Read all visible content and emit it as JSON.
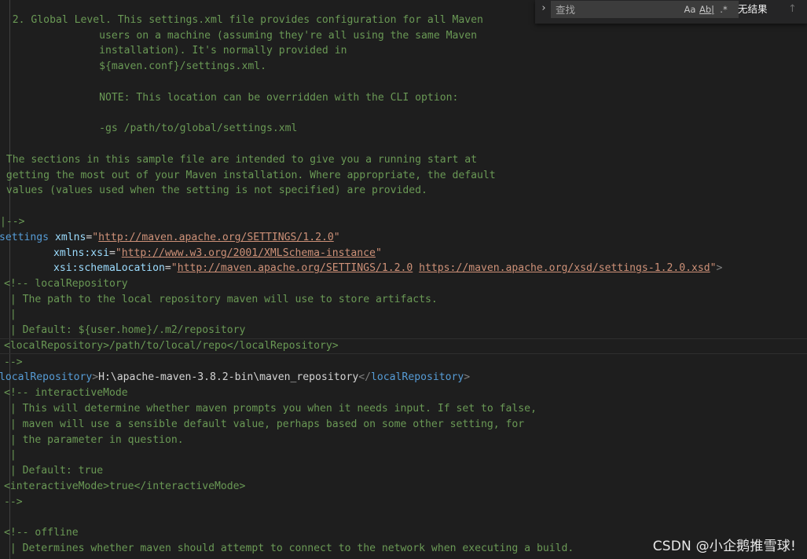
{
  "find": {
    "placeholder": "查找",
    "toggle_icon": "›",
    "match_case": "Aa",
    "whole_word": "Ab|",
    "regex": ".*",
    "result": "无结果",
    "prev_icon": "↑"
  },
  "watermark": "CSDN @小企鹅推雪球!",
  "code": {
    "l1": "  2. Global Level. This settings.xml file provides configuration for all Maven",
    "l2": "                users on a machine (assuming they're all using the same Maven",
    "l3": "                installation). It's normally provided in",
    "l4": "                ${maven.conf}/settings.xml.",
    "l6": "                NOTE: This location can be overridden with the CLI option:",
    "l8": "                -gs /path/to/global/settings.xml",
    "l10": " The sections in this sample file are intended to give you a running start at",
    "l11": " getting the most out of your Maven installation. Where appropriate, the default",
    "l12": " values (values used when the setting is not specified) are provided.",
    "l14": "|-->",
    "settings_tag": "settings",
    "xmlns_attr": "xmlns",
    "xmlns_val": "http://maven.apache.org/SETTINGS/1.2.0",
    "xsi_attr": "xmlns:xsi",
    "xsi_val": "http://www.w3.org/2001/XMLSchema-instance",
    "schema_attr": "xsi:schemaLocation",
    "schema_val1": "http://maven.apache.org/SETTINGS/1.2.0",
    "schema_val2": "https://maven.apache.org/xsd/settings-1.2.0.xsd",
    "lr_open": "<!-- localRepository",
    "lr_1": " | The path to the local repository maven will use to store artifacts.",
    "lr_2": " |",
    "lr_3": " | Default: ${user.home}/.m2/repository",
    "lr_example": "<localRepository>/path/to/local/repo</localRepository>",
    "lr_close": "-->",
    "lr_tag": "localRepository",
    "lr_value": "H:\\apache-maven-3.8.2-bin\\maven_repository",
    "im_open": "<!-- interactiveMode",
    "im_1": " | This will determine whether maven prompts you when it needs input. If set to false,",
    "im_2": " | maven will use a sensible default value, perhaps based on some other setting, for",
    "im_3": " | the parameter in question.",
    "im_4": " |",
    "im_5": " | Default: true",
    "im_example": "<interactiveMode>true</interactiveMode>",
    "im_close": "-->",
    "off_open": "<!-- offline",
    "off_1": " | Determines whether maven should attempt to connect to the network when executing a build."
  }
}
